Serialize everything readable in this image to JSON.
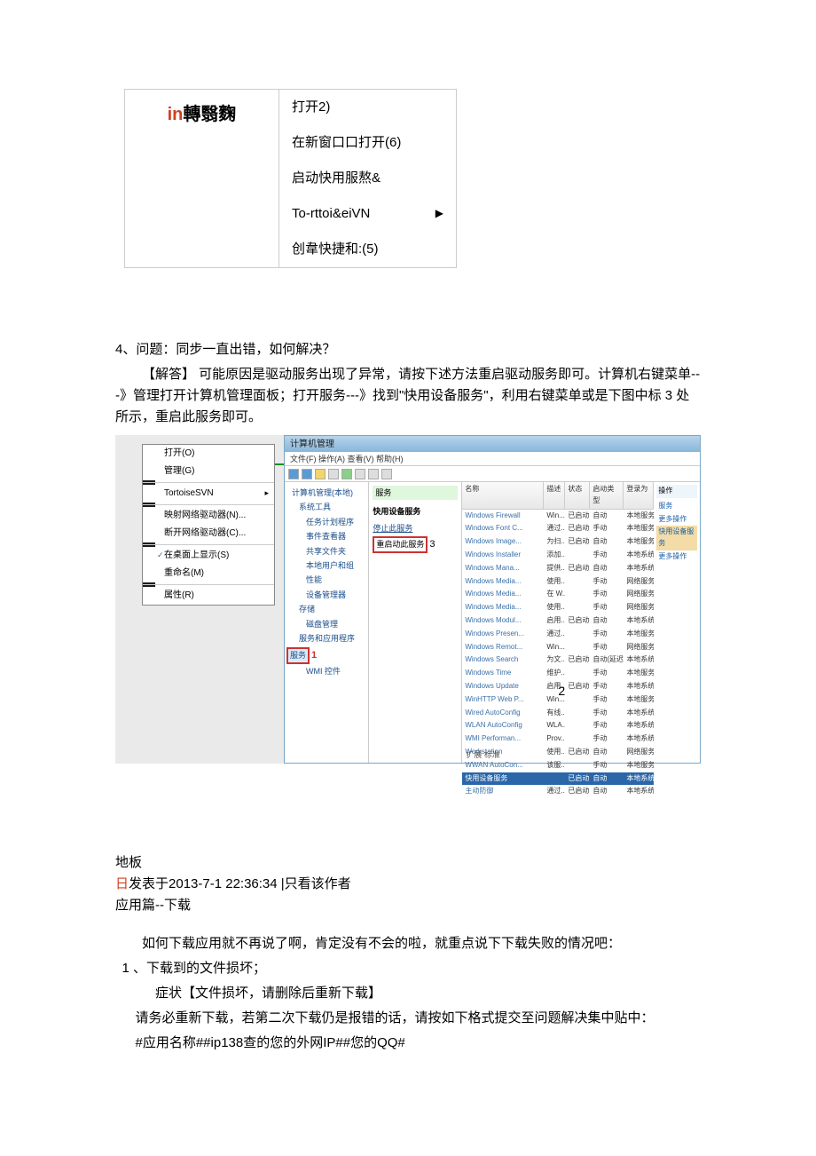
{
  "menu": {
    "left_red": "in",
    "left_rest": "轉翳麴",
    "items": [
      {
        "label": "打开2)"
      },
      {
        "label": "在新窗口口打开(6)"
      },
      {
        "label": "启动快用服熬&"
      },
      {
        "label": "To-rttoi&eiVN",
        "arrow": true
      },
      {
        "label": "创韋快捷和:(5)"
      }
    ]
  },
  "q4": {
    "title": "4、问题：同步一直出错，如何解决？",
    "p1": "【解答】 可能原因是驱动服务出现了异常，请按下述方法重启驱动服务即可。计算机右键菜单---》管理打开计算机管理面板；打开服务---》找到\"快用设备服务\"，利用右键菜单或是下图中标 3 处所示，重启此服务即可。"
  },
  "ctx": [
    "打开(O)",
    "管理(G)",
    "TortoiseSVN",
    "映射网络驱动器(N)...",
    "断开网络驱动器(C)...",
    "在桌面上显示(S)",
    "重命名(M)",
    "属性(R)"
  ],
  "mgmt": {
    "title": "计算机管理",
    "menu": "文件(F)  操作(A)  查看(V)  帮助(H)",
    "tree_root": "计算机管理(本地)",
    "tree": [
      {
        "t": "系统工具",
        "lv": 1
      },
      {
        "t": "任务计划程序",
        "lv": 2
      },
      {
        "t": "事件查看器",
        "lv": 2
      },
      {
        "t": "共享文件夹",
        "lv": 2
      },
      {
        "t": "本地用户和组",
        "lv": 2
      },
      {
        "t": "性能",
        "lv": 2
      },
      {
        "t": "设备管理器",
        "lv": 2
      },
      {
        "t": "存储",
        "lv": 1
      },
      {
        "t": "磁盘管理",
        "lv": 2
      },
      {
        "t": "服务和应用程序",
        "lv": 1
      }
    ],
    "tree_sel": "服务",
    "tree_wmi": "WMI 控件",
    "mark1": "1",
    "mid_title": "服务",
    "mid_sub": "快用设备服务",
    "mid_link1": "停止此服务",
    "mid_link2": "重启动此服务",
    "mark3": "3",
    "svc_head": [
      "名称",
      "描述",
      "状态",
      "启动类型",
      "登录为"
    ],
    "svc": [
      [
        "Windows Firewall",
        "Win...",
        "已启动",
        "自动",
        "本地服务"
      ],
      [
        "Windows Font C...",
        "通过...",
        "已启动",
        "手动",
        "本地服务"
      ],
      [
        "Windows Image...",
        "为扫...",
        "已启动",
        "自动",
        "本地服务"
      ],
      [
        "Windows Installer",
        "添加...",
        "",
        "手动",
        "本地系统"
      ],
      [
        "Windows Mana...",
        "提供...",
        "已启动",
        "自动",
        "本地系统"
      ],
      [
        "Windows Media...",
        "使用...",
        "",
        "手动",
        "网络服务"
      ],
      [
        "Windows Media...",
        "在 W...",
        "",
        "手动",
        "网络服务"
      ],
      [
        "Windows Media...",
        "使用...",
        "",
        "手动",
        "网络服务"
      ],
      [
        "Windows Modul...",
        "启用...",
        "已启动",
        "自动",
        "本地系统"
      ],
      [
        "Windows Presen...",
        "通过...",
        "",
        "手动",
        "本地服务"
      ],
      [
        "Windows Remot...",
        "Win...",
        "",
        "手动",
        "网络服务"
      ],
      [
        "Windows Search",
        "为文...",
        "已启动",
        "自动(延迟...",
        "本地系统"
      ],
      [
        "Windows Time",
        "维护...",
        "",
        "手动",
        "本地服务"
      ],
      [
        "Windows Update",
        "启用...",
        "已启动",
        "手动",
        "本地系统"
      ],
      [
        "WinHTTP Web P...",
        "Win...",
        "",
        "手动",
        "本地服务"
      ],
      [
        "Wired AutoConfig",
        "有线...",
        "",
        "手动",
        "本地系统"
      ],
      [
        "WLAN AutoConfig",
        "WLA...",
        "",
        "手动",
        "本地系统"
      ],
      [
        "WMI Performan...",
        "Prov...",
        "",
        "手动",
        "本地系统"
      ],
      [
        "Workstation",
        "使用...",
        "已启动",
        "自动",
        "网络服务"
      ],
      [
        "WWAN AutoCon...",
        "该服...",
        "",
        "手动",
        "本地服务"
      ]
    ],
    "svc_sel": [
      "快用设备服务",
      "",
      "已启动",
      "自动",
      "本地系统"
    ],
    "svc_last": [
      "主动防御",
      "通过...",
      "已启动",
      "自动",
      "本地系统"
    ],
    "mark2": "2",
    "tabs": "扩展  标准",
    "rp_head": "操作",
    "rp_items": [
      "服务",
      "更多操作",
      "快用设备服务",
      "更多操作"
    ]
  },
  "bottom": {
    "floor": "地板",
    "pub_prefix": "日",
    "pub_text": "发表于2013-7-1 22:36:34 |只看该作者",
    "section": "应用篇--下载",
    "p1": "如何下载应用就不再说了啊，肯定没有不会的啦，就重点说下下载失败的情况吧：",
    "li1": "1 、下载到的文件损坏；",
    "li1a": "症状【文件损坏，请删除后重新下载】",
    "p2": "请务必重新下载，若第二次下载仍是报错的话，请按如下格式提交至问题解决集中贴中：",
    "p3": "#应用名称##ip138查的您的外网IP##您的QQ#"
  }
}
